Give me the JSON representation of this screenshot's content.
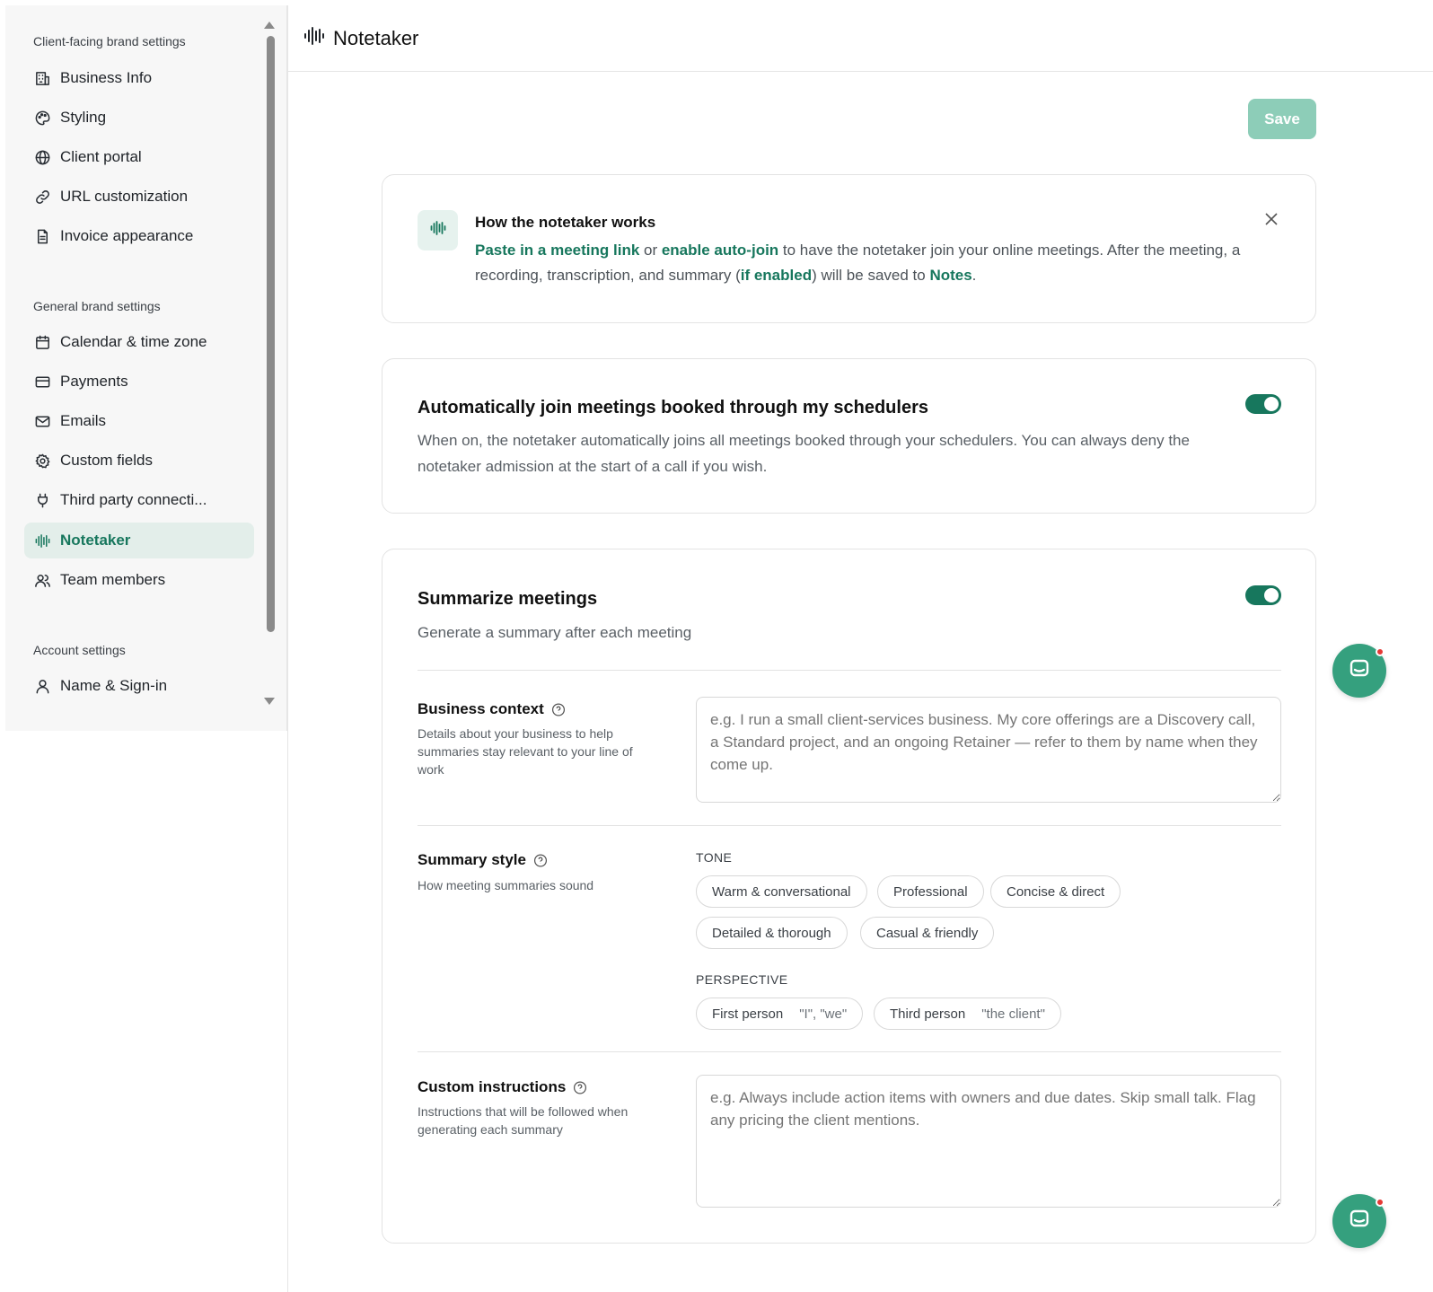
{
  "sidebar": {
    "sections": [
      {
        "title": "Client-facing brand settings",
        "items": [
          {
            "label": "Business Info",
            "icon": "building-icon"
          },
          {
            "label": "Styling",
            "icon": "palette-icon"
          },
          {
            "label": "Client portal",
            "icon": "globe-icon"
          },
          {
            "label": "URL customization",
            "icon": "link-icon"
          },
          {
            "label": "Invoice appearance",
            "icon": "document-icon"
          }
        ]
      },
      {
        "title": "General brand settings",
        "items": [
          {
            "label": "Calendar & time zone",
            "icon": "calendar-icon"
          },
          {
            "label": "Payments",
            "icon": "credit-card-icon"
          },
          {
            "label": "Emails",
            "icon": "mail-icon"
          },
          {
            "label": "Custom fields",
            "icon": "gear-icon"
          },
          {
            "label": "Third party connecti...",
            "icon": "plug-icon"
          },
          {
            "label": "Notetaker",
            "icon": "waveform-icon",
            "active": true
          },
          {
            "label": "Team members",
            "icon": "users-icon"
          }
        ]
      },
      {
        "title": "Account settings",
        "items": [
          {
            "label": "Name & Sign-in",
            "icon": "user-icon"
          }
        ]
      }
    ]
  },
  "header": {
    "title": "Notetaker"
  },
  "toolbar": {
    "save_label": "Save"
  },
  "info_card": {
    "title": "How the notetaker works",
    "link1": "Paste in a meeting link",
    "text1": " or ",
    "link2": "enable auto-join",
    "text2": " to have the notetaker join your online meetings. After the meeting, a recording, transcription, and summary (",
    "link3": "if enabled",
    "text3": ") will be saved to ",
    "link4": "Notes",
    "text4": "."
  },
  "auto_join": {
    "title": "Automatically join meetings booked through my schedulers",
    "description": "When on, the notetaker automatically joins all meetings booked through your schedulers. You can always deny the notetaker admission at the start of a call if you wish.",
    "enabled": true
  },
  "summarize": {
    "title": "Summarize meetings",
    "description": "Generate a summary after each meeting",
    "enabled": true,
    "business_context": {
      "label": "Business context",
      "sublabel": "Details about your business to help summaries stay relevant to your line of work",
      "placeholder": "e.g. I run a small client-services business. My core offerings are a Discovery call, a Standard project, and an ongoing Retainer — refer to them by name when they come up.",
      "value": ""
    },
    "summary_style": {
      "label": "Summary style",
      "sublabel": "How meeting summaries sound",
      "tone_label": "TONE",
      "tones": [
        "Warm & conversational",
        "Professional",
        "Concise & direct",
        "Detailed & thorough",
        "Casual & friendly"
      ],
      "perspective_label": "PERSPECTIVE",
      "perspectives": [
        {
          "label": "First person",
          "hint": "\"I\", \"we\""
        },
        {
          "label": "Third person",
          "hint": "\"the client\""
        }
      ]
    },
    "custom_instructions": {
      "label": "Custom instructions",
      "sublabel": "Instructions that will be followed when generating each summary",
      "placeholder": "e.g. Always include action items with owners and due dates. Skip small talk. Flag any pricing the client mentions.",
      "value": ""
    }
  },
  "colors": {
    "accent": "#17775d",
    "save_disabled": "#8dcdb8",
    "chat": "#35a07e",
    "notification": "#e53935"
  }
}
